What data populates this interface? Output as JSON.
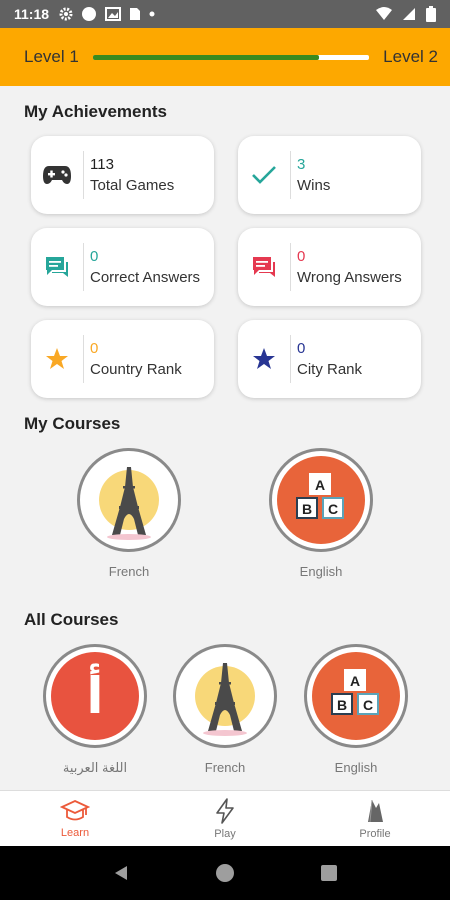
{
  "status": {
    "time": "11:18"
  },
  "level": {
    "current_label": "Level 1",
    "next_label": "Level 2",
    "progress": 0.82
  },
  "achievements": {
    "title": "My Achievements",
    "cards": [
      {
        "value": "113",
        "label": "Total Games",
        "icon": "gamepad-icon",
        "color": "#333333"
      },
      {
        "value": "3",
        "label": "Wins",
        "icon": "check-icon",
        "color": "#26a69a"
      },
      {
        "value": "0",
        "label": "Correct Answers",
        "icon": "chat-icon",
        "color": "#26a69a"
      },
      {
        "value": "0",
        "label": "Wrong Answers",
        "icon": "chat-icon",
        "color": "#e53950"
      },
      {
        "value": "0",
        "label": "Country Rank",
        "icon": "star-icon",
        "color": "#f9a825"
      },
      {
        "value": "0",
        "label": "City Rank",
        "icon": "star-icon",
        "color": "#283593"
      }
    ]
  },
  "my_courses": {
    "title": "My Courses",
    "items": [
      {
        "name": "French",
        "icon": "eiffel-tower-icon"
      },
      {
        "name": "English",
        "icon": "abc-blocks-icon"
      }
    ]
  },
  "all_courses": {
    "title": "All Courses",
    "items": [
      {
        "name": "اللغة العربية",
        "icon": "arabic-letter-icon"
      },
      {
        "name": "French",
        "icon": "eiffel-tower-icon"
      },
      {
        "name": "English",
        "icon": "abc-blocks-icon"
      }
    ]
  },
  "arabic_glyph": "أ",
  "blocks": {
    "a": "A",
    "b": "B",
    "c": "C"
  },
  "nav": {
    "items": [
      {
        "label": "Learn",
        "icon": "graduation-cap-icon",
        "active": true
      },
      {
        "label": "Play",
        "icon": "lightning-icon",
        "active": false
      },
      {
        "label": "Profile",
        "icon": "flame-icon",
        "active": false
      }
    ]
  },
  "colors": {
    "accent": "#fda800",
    "progress_fill": "#3a8a1f",
    "nav_active": "#ec5a3a",
    "course_orange": "#e8643a"
  }
}
